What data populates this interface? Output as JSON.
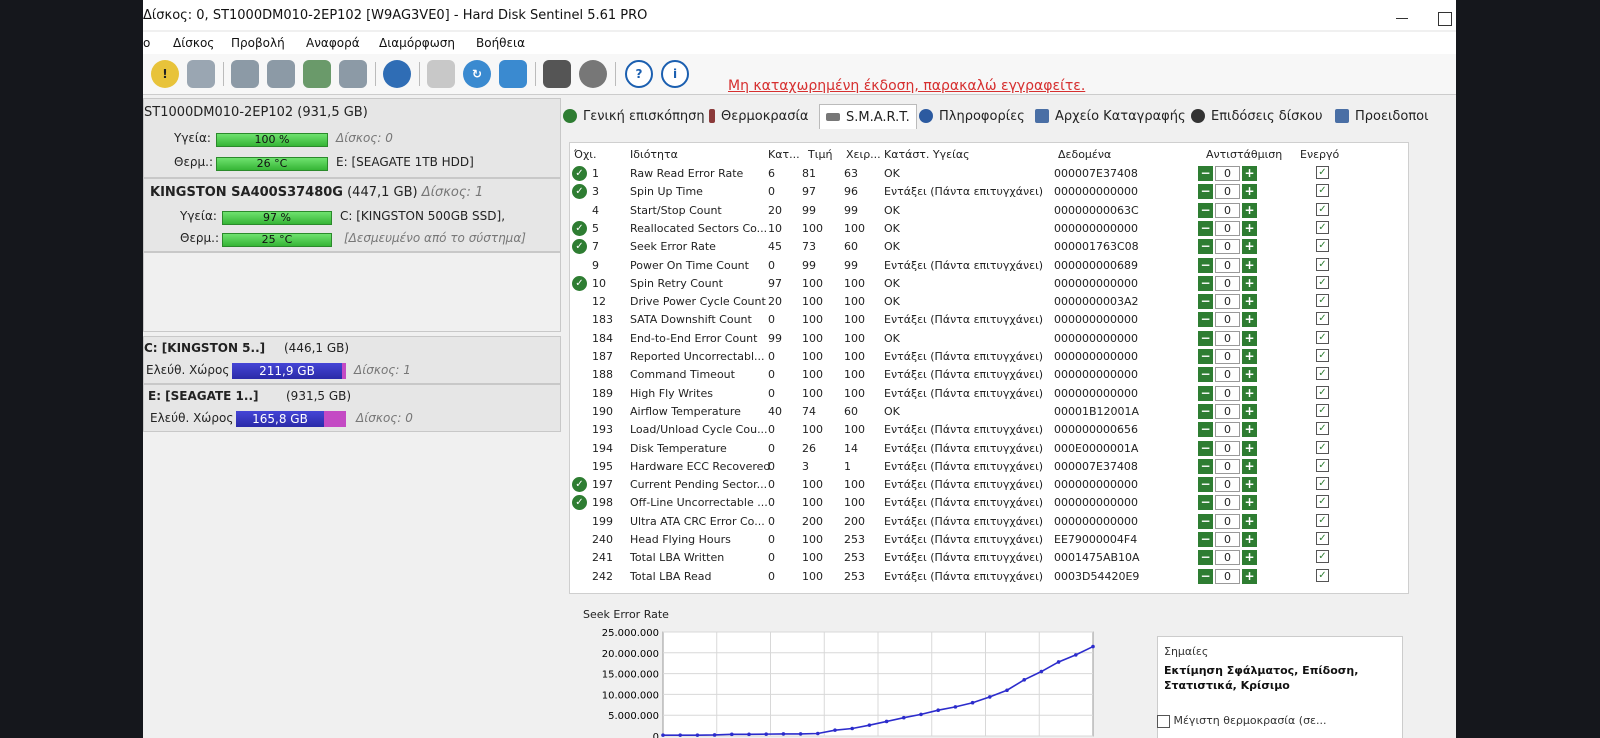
{
  "window": {
    "title": "Δίσκος: 0, ST1000DM010-2EP102 [W9AG3VE0]  -  Hard Disk Sentinel 5.61 PRO"
  },
  "menu": [
    "ο",
    "Δίσκος",
    "Προβολή",
    "Αναφορά",
    "Διαμόρφωση",
    "Βοήθεια"
  ],
  "toolbar": {
    "register_notice": "Μη καταχωρημένη έκδοση, παρακαλώ εγγραφείτε."
  },
  "disks": [
    {
      "name": "ST1000DM010-2EP102",
      "size": "(931,5 GB)",
      "health_label": "Υγεία:",
      "health": "100 %",
      "health_value": 100,
      "disk_label": "Δίσκος: 0",
      "temp_label": "Θερμ.:",
      "temp": "26 °C",
      "volume": "E: [SEAGATE 1TB HDD]"
    },
    {
      "name": "KINGSTON SA400S37480G",
      "size": "(447,1 GB)",
      "health_label": "Υγεία:",
      "health": "97 %",
      "health_value": 97,
      "disk_label": "Δίσκος: 1",
      "temp_label": "Θερμ.:",
      "temp": "25 °C",
      "volume": "C: [KINGSTON 500GB SSD],",
      "volume_note": "[Δεσμευμένο από το σύστημα]"
    }
  ],
  "volumes": [
    {
      "name": "C: [KINGSTON 5..]",
      "size": "(446,1 GB)",
      "free_label": "Ελεύθ. Χώρος",
      "free": "211,9 GB",
      "disk_label": "Δίσκος: 1"
    },
    {
      "name": "E: [SEAGATE 1..]",
      "size": "(931,5 GB)",
      "free_label": "Ελεύθ. Χώρος",
      "free": "165,8 GB",
      "disk_label": "Δίσκος: 0"
    }
  ],
  "tabs": [
    {
      "label": "Γενική επισκόπηση",
      "color": "#2e7d32"
    },
    {
      "label": "Θερμοκρασία",
      "color": "#8b3a3a"
    },
    {
      "label": "S.M.A.R.T.",
      "color": "#777777"
    },
    {
      "label": "Πληροφορίες",
      "color": "#2c5aa0"
    },
    {
      "label": "Αρχείο Καταγραφής",
      "color": "#4a6fa5"
    },
    {
      "label": "Επιδόσεις δίσκου",
      "color": "#333333"
    },
    {
      "label": "Προειδοποι",
      "color": "#4a6fa5"
    }
  ],
  "smart": {
    "headers": [
      "Όχι.",
      "Ιδιότητα",
      "Κατ...",
      "Τιμή",
      "Χειρ...",
      "Κατάστ. Υγείας",
      "Δεδομένα",
      "Αντιστάθμιση",
      "Ενεργό"
    ],
    "rows": [
      {
        "id": "1",
        "attr": "Raw Read Error Rate",
        "thr": "6",
        "val": "81",
        "worst": "63",
        "status": "OK",
        "data": "000007E37408",
        "comp": "0",
        "icon": true
      },
      {
        "id": "3",
        "attr": "Spin Up Time",
        "thr": "0",
        "val": "97",
        "worst": "96",
        "status": "Εντάξει (Πάντα επιτυγχάνει)",
        "data": "000000000000",
        "comp": "0",
        "icon": true
      },
      {
        "id": "4",
        "attr": "Start/Stop Count",
        "thr": "20",
        "val": "99",
        "worst": "99",
        "status": "OK",
        "data": "00000000063C",
        "comp": "0",
        "icon": false
      },
      {
        "id": "5",
        "attr": "Reallocated Sectors Co...",
        "thr": "10",
        "val": "100",
        "worst": "100",
        "status": "OK",
        "data": "000000000000",
        "comp": "0",
        "icon": true
      },
      {
        "id": "7",
        "attr": "Seek Error Rate",
        "thr": "45",
        "val": "73",
        "worst": "60",
        "status": "OK",
        "data": "000001763C08",
        "comp": "0",
        "icon": true
      },
      {
        "id": "9",
        "attr": "Power On Time Count",
        "thr": "0",
        "val": "99",
        "worst": "99",
        "status": "Εντάξει (Πάντα επιτυγχάνει)",
        "data": "000000000689",
        "comp": "0",
        "icon": false
      },
      {
        "id": "10",
        "attr": "Spin Retry Count",
        "thr": "97",
        "val": "100",
        "worst": "100",
        "status": "OK",
        "data": "000000000000",
        "comp": "0",
        "icon": true
      },
      {
        "id": "12",
        "attr": "Drive Power Cycle Count",
        "thr": "20",
        "val": "100",
        "worst": "100",
        "status": "OK",
        "data": "0000000003A2",
        "comp": "0",
        "icon": false
      },
      {
        "id": "183",
        "attr": "SATA Downshift Count",
        "thr": "0",
        "val": "100",
        "worst": "100",
        "status": "Εντάξει (Πάντα επιτυγχάνει)",
        "data": "000000000000",
        "comp": "0",
        "icon": false
      },
      {
        "id": "184",
        "attr": "End-to-End Error Count",
        "thr": "99",
        "val": "100",
        "worst": "100",
        "status": "OK",
        "data": "000000000000",
        "comp": "0",
        "icon": false
      },
      {
        "id": "187",
        "attr": "Reported Uncorrectabl...",
        "thr": "0",
        "val": "100",
        "worst": "100",
        "status": "Εντάξει (Πάντα επιτυγχάνει)",
        "data": "000000000000",
        "comp": "0",
        "icon": false
      },
      {
        "id": "188",
        "attr": "Command Timeout",
        "thr": "0",
        "val": "100",
        "worst": "100",
        "status": "Εντάξει (Πάντα επιτυγχάνει)",
        "data": "000000000000",
        "comp": "0",
        "icon": false
      },
      {
        "id": "189",
        "attr": "High Fly Writes",
        "thr": "0",
        "val": "100",
        "worst": "100",
        "status": "Εντάξει (Πάντα επιτυγχάνει)",
        "data": "000000000000",
        "comp": "0",
        "icon": false
      },
      {
        "id": "190",
        "attr": "Airflow Temperature",
        "thr": "40",
        "val": "74",
        "worst": "60",
        "status": "OK",
        "data": "00001B12001A",
        "comp": "0",
        "icon": false
      },
      {
        "id": "193",
        "attr": "Load/Unload Cycle Cou...",
        "thr": "0",
        "val": "100",
        "worst": "100",
        "status": "Εντάξει (Πάντα επιτυγχάνει)",
        "data": "000000000656",
        "comp": "0",
        "icon": false
      },
      {
        "id": "194",
        "attr": "Disk Temperature",
        "thr": "0",
        "val": "26",
        "worst": "14",
        "status": "Εντάξει (Πάντα επιτυγχάνει)",
        "data": "000E0000001A",
        "comp": "0",
        "icon": false
      },
      {
        "id": "195",
        "attr": "Hardware ECC Recovered",
        "thr": "0",
        "val": "3",
        "worst": "1",
        "status": "Εντάξει (Πάντα επιτυγχάνει)",
        "data": "000007E37408",
        "comp": "0",
        "icon": false
      },
      {
        "id": "197",
        "attr": "Current Pending Sector...",
        "thr": "0",
        "val": "100",
        "worst": "100",
        "status": "Εντάξει (Πάντα επιτυγχάνει)",
        "data": "000000000000",
        "comp": "0",
        "icon": true
      },
      {
        "id": "198",
        "attr": "Off-Line Uncorrectable ...",
        "thr": "0",
        "val": "100",
        "worst": "100",
        "status": "Εντάξει (Πάντα επιτυγχάνει)",
        "data": "000000000000",
        "comp": "0",
        "icon": true
      },
      {
        "id": "199",
        "attr": "Ultra ATA CRC Error Co...",
        "thr": "0",
        "val": "200",
        "worst": "200",
        "status": "Εντάξει (Πάντα επιτυγχάνει)",
        "data": "000000000000",
        "comp": "0",
        "icon": false
      },
      {
        "id": "240",
        "attr": "Head Flying Hours",
        "thr": "0",
        "val": "100",
        "worst": "253",
        "status": "Εντάξει (Πάντα επιτυγχάνει)",
        "data": "EE79000004F4",
        "comp": "0",
        "icon": false
      },
      {
        "id": "241",
        "attr": "Total LBA Written",
        "thr": "0",
        "val": "100",
        "worst": "253",
        "status": "Εντάξει (Πάντα επιτυγχάνει)",
        "data": "0001475AB10A",
        "comp": "0",
        "icon": false
      },
      {
        "id": "242",
        "attr": "Total LBA Read",
        "thr": "0",
        "val": "100",
        "worst": "253",
        "status": "Εντάξει (Πάντα επιτυγχάνει)",
        "data": "0003D54420E9",
        "comp": "0",
        "icon": false
      }
    ]
  },
  "chart_panel": {
    "title": "Seek Error Rate",
    "notes_label": "Σημαίες",
    "notes_value": "Εκτίμηση Σφάλματος, Επίδοση, Στατιστικά, Κρίσιμο",
    "max_temp_label": "Μέγιστη θερμοκρασία (σε..."
  },
  "chart_data": {
    "type": "line",
    "title": "Seek Error Rate",
    "xlabel": "",
    "ylabel": "",
    "ylim": [
      0,
      25000000
    ],
    "y_ticks": [
      "25.000.000",
      "20.000.000",
      "15.000.000",
      "10.000.000",
      "5.000.000",
      "0"
    ],
    "grid": true,
    "color": "#2c2ccc",
    "x": [
      0,
      1,
      2,
      3,
      4,
      5,
      6,
      7,
      8,
      9,
      10,
      11,
      12,
      13,
      14,
      15,
      16,
      17,
      18,
      19,
      20,
      21,
      22,
      23,
      24,
      25
    ],
    "values": [
      200000,
      200000,
      200000,
      250000,
      400000,
      400000,
      450000,
      500000,
      500000,
      600000,
      1400000,
      1800000,
      2600000,
      3500000,
      4400000,
      5200000,
      6200000,
      7000000,
      8000000,
      9400000,
      11000000,
      13500000,
      15500000,
      17800000,
      19500000,
      21500000
    ]
  }
}
